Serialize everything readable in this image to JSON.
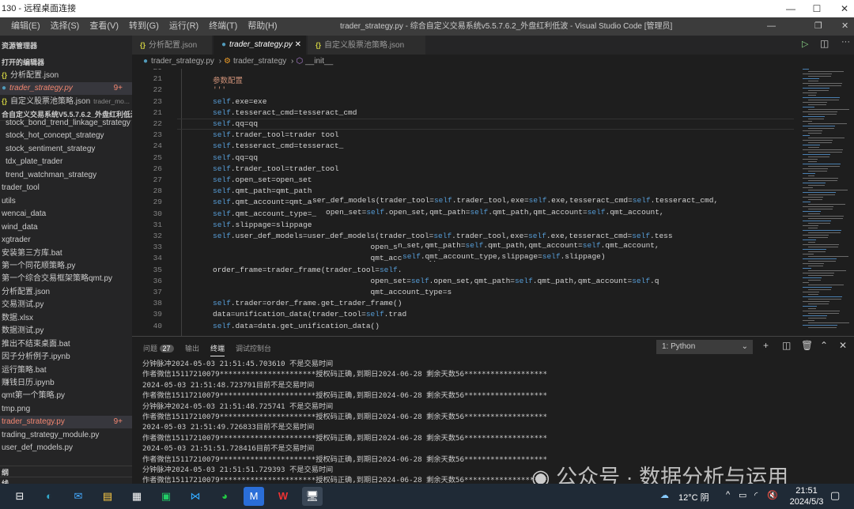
{
  "rdp": {
    "title": "130 - 远程桌面连接"
  },
  "menu": [
    "编辑(E)",
    "选择(S)",
    "查看(V)",
    "转到(G)",
    "运行(R)",
    "终端(T)",
    "帮助(H)"
  ],
  "window_title": "trader_strategy.py - 综合自定义交易系统v5.5.7.6.2_外盘红利低波 - Visual Studio Code [管理员]",
  "sidebar": {
    "explorer": "资源管理器",
    "open_editors": "打开的编辑器",
    "open_files": [
      {
        "label": "分析配置.json",
        "type": "json"
      },
      {
        "label": "trader_strategy.py",
        "type": "py",
        "badge": "9+",
        "selected": true
      },
      {
        "label": "自定义股票池策略.json",
        "type": "json",
        "hint": "trader_mo..."
      }
    ],
    "project": "合自定义交易系统V5.5.7.6.2_外盘红利低波",
    "tree": [
      "stock_bond_trend_linkage_strategy",
      "stock_hot_concept_strategy",
      "stock_sentiment_strategy",
      "tdx_plate_trader",
      "trend_watchman_strategy",
      "trader_tool",
      "utils",
      "wencai_data",
      "wind_data",
      "xgtrader",
      "安装第三方库.bat",
      "第一个同花顺策略.py",
      "第一个综合交易框架策略qmt.py",
      "分析配置.json",
      "交易测试.py",
      "数据.xlsx",
      "数据测试.py",
      "推出不结束桌面.bat",
      "因子分析例子.ipynb",
      "运行策略.bat",
      "赚钱日历.ipynb",
      "qmt第一个策略.py",
      "tmp.png",
      "trader_strategy.py",
      "trading_strategy_module.py",
      "user_def_models.py"
    ],
    "tree_selected_badge": "9+",
    "outline": "纲",
    "timeline": "线"
  },
  "tabs": [
    {
      "label": "分析配置.json",
      "type": "json"
    },
    {
      "label": "trader_strategy.py",
      "type": "py",
      "active": true
    },
    {
      "label": "自定义股票池策略.json",
      "type": "json"
    }
  ],
  "breadcrumb": [
    "trader_strategy.py",
    "trader_strategy",
    "__init__"
  ],
  "code": [
    {
      "n": "20",
      "t": ""
    },
    {
      "n": "21",
      "t": "参数配置",
      "s": 1
    },
    {
      "n": "22",
      "t": "'''",
      "s": 1
    },
    {
      "n": "23",
      "t": "self.exe=exe"
    },
    {
      "n": "21",
      "t": "self.tesseract_cmd=tesseract_cmd"
    },
    {
      "n": "22",
      "t": "self.qq=qq"
    },
    {
      "n": "23",
      "t": "self.trader_tool=trader tool"
    },
    {
      "n": "24",
      "t": "self.tesseract_cmd=tesseract_"
    },
    {
      "n": "25",
      "t": "self.qq=qq"
    },
    {
      "n": "26",
      "t": "self.trader_tool=trader_tool"
    },
    {
      "n": "27",
      "t": "self.open_set=open_set"
    },
    {
      "n": "28",
      "t": "self.qmt_path=qmt_path"
    },
    {
      "n": "29",
      "t": "self.qmt_account=qmt_a",
      "ov": "ser_def_models(trader_tool=self.trader_tool,exe=self.exe,tesseract_cmd=self.tesseract_cmd,"
    },
    {
      "n": "30",
      "t": "self.qmt_account_type=_",
      "ov": "open_set=self.open_set,qmt_path=self.qmt_path,qmt_account=self.qmt_account,"
    },
    {
      "n": "31",
      "t": "self.slippage=slippage"
    },
    {
      "n": "32",
      "t": "self.user_def_models=user_def_models(trader_tool=self.trader_tool,exe=self.exe,tesseract_cmd=self.tess"
    },
    {
      "n": "33",
      "t": "                                   open_set=self.ope",
      "ov": "n_set,qmt_path=self.qmt_path,qmt_account=self.qmt_account,"
    },
    {
      "n": "34",
      "t": "                                   qmt_account_type=",
      "ov": "self.qmt_account_type,slippage=self.slippage)"
    },
    {
      "n": "35",
      "t": "order_frame=trader_frame(trader_tool=self."
    },
    {
      "n": "36",
      "t": "                                   open_set=self.open_set,qmt_path=self.qmt_path,qmt_account=self.q"
    },
    {
      "n": "37",
      "t": "                                   qmt_account_type=s"
    },
    {
      "n": "38",
      "t": "self.trader=order_frame.get_trader_frame()"
    },
    {
      "n": "39",
      "t": "data=unification_data(trader_tool=self.trad"
    },
    {
      "n": "40",
      "t": "self.data=data.get_unification_data()"
    }
  ],
  "panel": {
    "tabs": [
      "问题",
      "输出",
      "终端",
      "调试控制台"
    ],
    "problems_count": "27",
    "terminal_select": "1: Python",
    "terminal": [
      "分钟脉冲2024-05-03 21:51:45.703610 不是交易时间",
      "作者微信15117210079**********************授权码正确,到期日2024-06-28 剩余天数56*******************",
      "2024-05-03 21:51:48.723791目前不是交易时间",
      "作者微信15117210079**********************授权码正确,到期日2024-06-28 剩余天数56*******************",
      "分钟脉冲2024-05-03 21:51:48.725741 不是交易时间",
      "作者微信15117210079**********************授权码正确,到期日2024-06-28 剩余天数56*******************",
      "2024-05-03 21:51:49.726833目前不是交易时间",
      "作者微信15117210079**********************授权码正确,到期日2024-06-28 剩余天数56*******************",
      "2024-05-03 21:51:51.728416目前不是交易时间",
      "作者微信15117210079**********************授权码正确,到期日2024-06-28 剩余天数56*******************",
      "分钟脉冲2024-05-03 21:51:51.729393 不是交易时间",
      "作者微信15117210079**********************授权码正确,到期日2024-06-28 剩余天数56*******************",
      "2024-05-03 21:51:53.750625目前不是交易时间"
    ]
  },
  "watermark": "公众号 · 数据分析与运用",
  "tray": {
    "weather": "12°C 阴",
    "time": "21:51",
    "date": "2024/5/3"
  },
  "colors": {
    "accent": "#007acc",
    "error": "#f48771",
    "keyword": "#569cd6",
    "string": "#ce9178"
  }
}
